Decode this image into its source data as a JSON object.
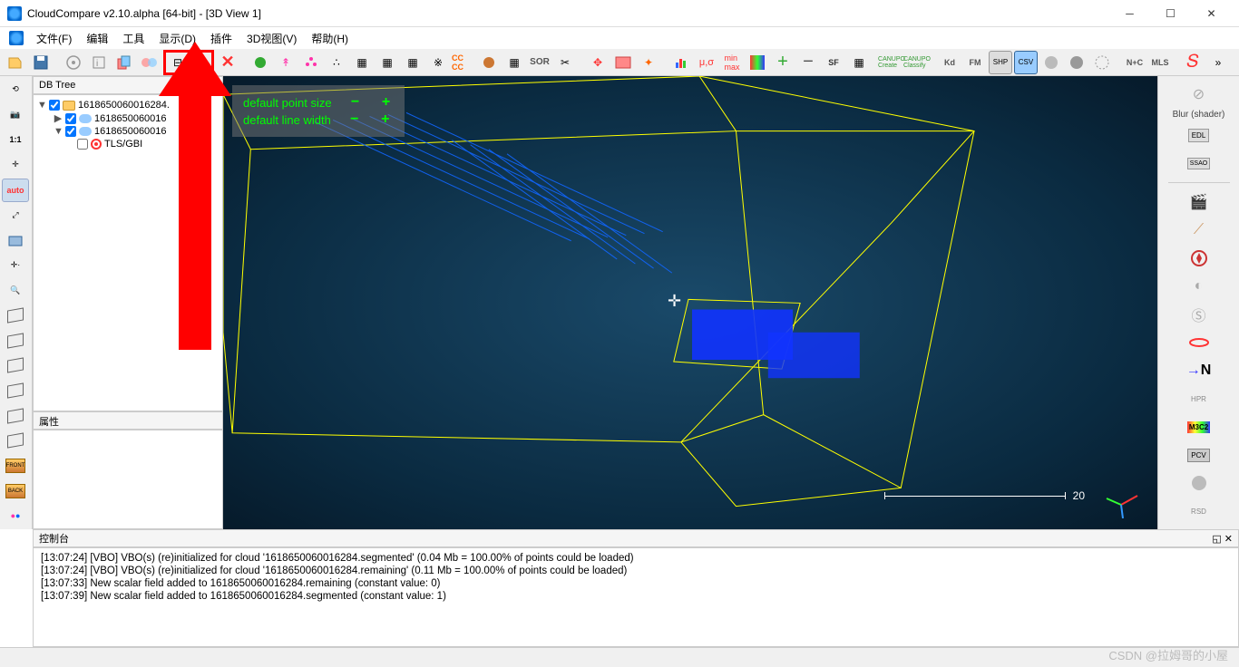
{
  "title": "CloudCompare v2.10.alpha [64-bit] - [3D View 1]",
  "menubar": {
    "items": [
      "文件(F)",
      "编辑",
      "工具",
      "显示(D)",
      "插件",
      "3D视图(V)",
      "帮助(H)"
    ]
  },
  "db_tree": {
    "header": "DB Tree",
    "root": {
      "label": "1618650060016284.",
      "children": [
        {
          "label": "1618650060016"
        },
        {
          "label": "1618650060016",
          "children": [
            {
              "label": "TLS/GBI"
            }
          ]
        }
      ]
    }
  },
  "properties_header": "属性",
  "viewport": {
    "overlay": {
      "row1": "default point size",
      "row2": "default line width"
    },
    "scale_value": "20"
  },
  "right_panel": {
    "label": "Blur (shader)",
    "edl": "EDL",
    "ssao": "SSAO",
    "n": "N",
    "hpr": "HPR",
    "m3c2": "M3C2",
    "pcv": "PCV",
    "rsd": "RSD"
  },
  "console": {
    "header": "控制台",
    "lines": [
      "[13:07:24] [VBO] VBO(s) (re)initialized for cloud '1618650060016284.segmented' (0.04 Mb = 100.00% of points could be loaded)",
      "[13:07:24] [VBO] VBO(s) (re)initialized for cloud '1618650060016284.remaining' (0.11 Mb = 100.00% of points could be loaded)",
      "[13:07:33] New scalar field added to 1618650060016284.remaining (constant value: 0)",
      "[13:07:39] New scalar field added to 1618650060016284.segmented (constant value: 1)"
    ]
  },
  "left_toolbar": {
    "text_1_1": "1:1",
    "text_auto": "auto",
    "text_front": "FRONT",
    "text_back": "BACK"
  },
  "main_toolbar": {
    "cc_cc": "CC\nCC",
    "sor": "SOR",
    "sf": "SF",
    "kd": "Kd",
    "fm": "FM",
    "nc": "N+C",
    "mls": "MLS"
  },
  "watermark": "CSDN @拉姆哥的小屋"
}
